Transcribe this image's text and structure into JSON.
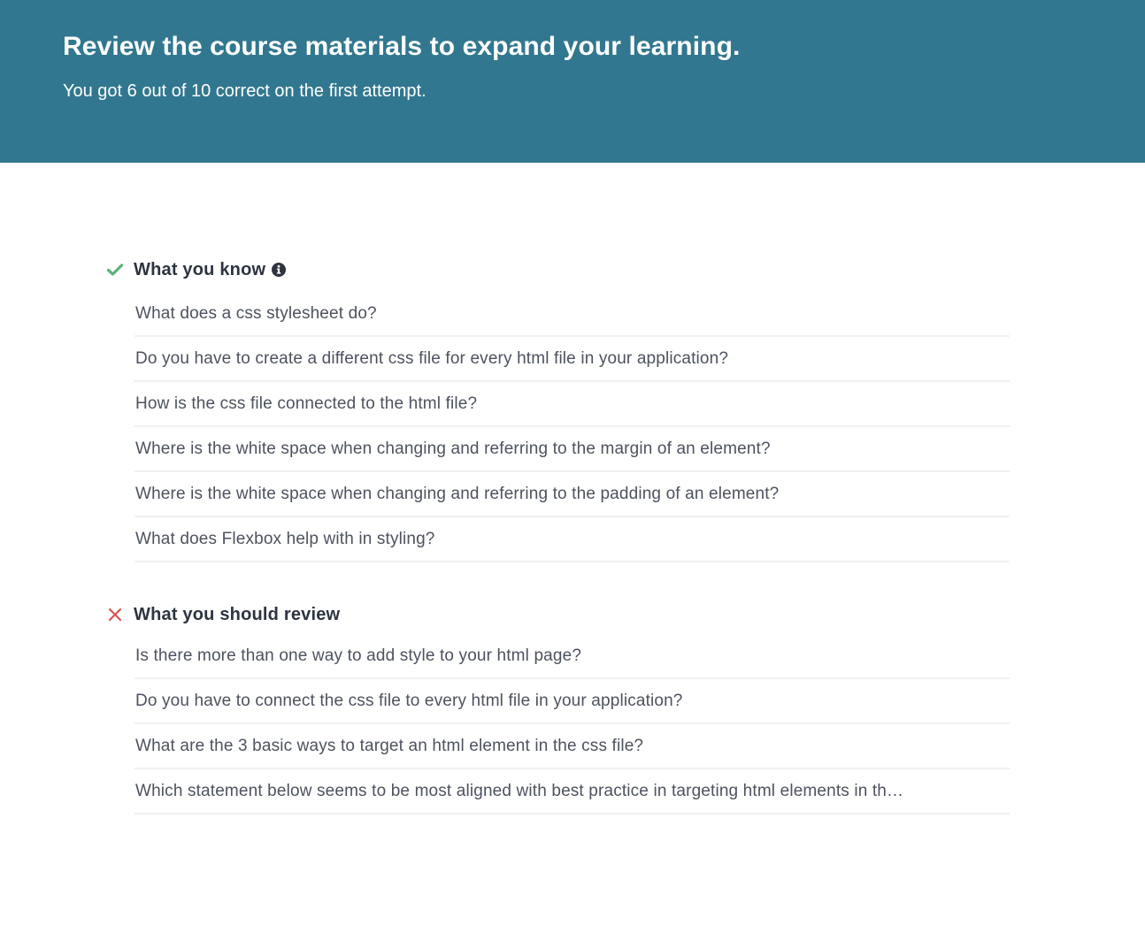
{
  "banner": {
    "title": "Review the course materials to expand your learning.",
    "subtitle": "You got 6 out of 10 correct on the first attempt.",
    "background": "#31778f"
  },
  "know_section": {
    "title": "What you know",
    "icon": "check-icon",
    "icon_color": "#5cb37c",
    "info_icon": "info-icon",
    "questions": [
      "What does a css stylesheet do?",
      "Do you have to create a different css file for every html file in your application?",
      "How is the css file connected to the html file?",
      "Where is the white space when changing and referring to the margin of an element?",
      "Where is the white space when changing and referring to the padding of an element?",
      "What does Flexbox help with in styling?"
    ]
  },
  "review_section": {
    "title": "What you should review",
    "icon": "x-icon",
    "icon_color": "#d9534f",
    "questions": [
      "Is there more than one way to add style to your html page?",
      "Do you have to connect the css file to every html file in your application?",
      "What are the 3 basic ways to target an html element in the css file?",
      "Which statement below seems to be most aligned with best practice in targeting html elements in th…"
    ]
  }
}
